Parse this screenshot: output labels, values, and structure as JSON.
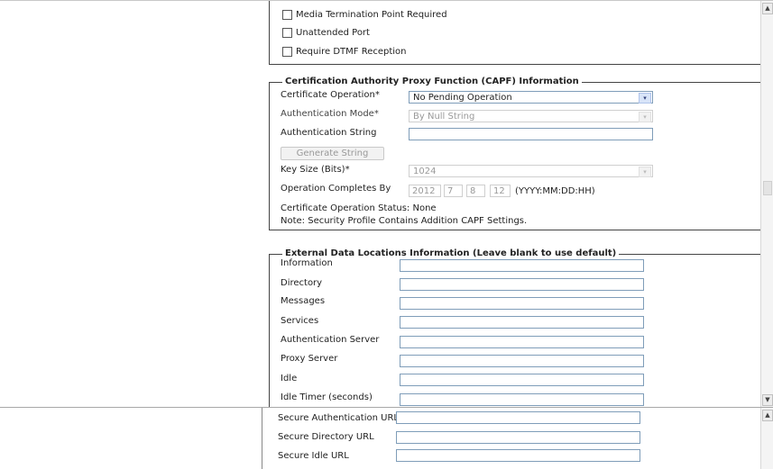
{
  "checkboxes": [
    {
      "label": "Media Termination Point Required",
      "checked": false
    },
    {
      "label": "Unattended Port",
      "checked": false
    },
    {
      "label": "Require DTMF Reception",
      "checked": false
    }
  ],
  "capf": {
    "legend": "Certification Authority Proxy Function (CAPF) Information",
    "certificate_operation_label": "Certificate Operation",
    "certificate_operation_value": "No Pending Operation",
    "authentication_mode_label": "Authentication Mode",
    "authentication_mode_value": "By Null String",
    "authentication_string_label": "Authentication String",
    "authentication_string_value": "",
    "generate_string_label": "Generate String",
    "key_size_label": "Key Size (Bits)",
    "key_size_value": "1024",
    "operation_completes_label": "Operation Completes By",
    "op_year": "2012",
    "op_month": "7",
    "op_day": "8",
    "op_hour": "12",
    "op_format": "(YYYY:MM:DD:HH)",
    "status_text": "Certificate Operation Status: None",
    "note_text": "Note: Security Profile Contains Addition CAPF Settings.",
    "required_mark": "*"
  },
  "external": {
    "legend": "External Data Locations Information (Leave blank to use default)",
    "fields": [
      {
        "label": "Information",
        "value": ""
      },
      {
        "label": "Directory",
        "value": ""
      },
      {
        "label": "Messages",
        "value": ""
      },
      {
        "label": "Services",
        "value": ""
      },
      {
        "label": "Authentication Server",
        "value": ""
      },
      {
        "label": "Proxy Server",
        "value": ""
      },
      {
        "label": "Idle",
        "value": ""
      },
      {
        "label": "Idle Timer (seconds)",
        "value": ""
      }
    ]
  },
  "secure_urls": [
    {
      "label": "Secure Authentication URL",
      "value": ""
    },
    {
      "label": "Secure Directory URL",
      "value": ""
    },
    {
      "label": "Secure Idle URL",
      "value": ""
    }
  ],
  "icons": {
    "dropdown": "▾",
    "scroll_up": "▲",
    "scroll_down": "▼"
  }
}
